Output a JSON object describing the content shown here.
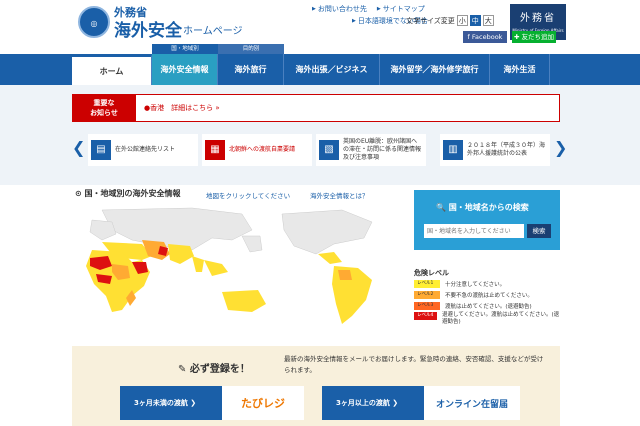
{
  "header": {
    "logo_top": "外務省",
    "logo_main": "海外安全",
    "logo_sub": "ホームページ",
    "links": [
      "お問い合わせ先",
      "サイトマップ",
      "日本語環境でない場合"
    ],
    "font_size_label": "文字サイズ変更",
    "font_sizes": [
      "小",
      "中",
      "大"
    ],
    "mofa": "外務省",
    "mofa_sub": "Ministry of Foreign Affairs of Japan",
    "facebook": "Facebook",
    "line": "友だち追加"
  },
  "subtabs": [
    "国・地域別",
    "目的別"
  ],
  "nav": [
    "ホーム",
    "海外安全情報",
    "海外旅行",
    "海外出張／ビジネス",
    "海外留学／海外修学旅行",
    "海外生活"
  ],
  "notice": {
    "label": "重要な\nお知らせ",
    "text": "●香港　詳細はこちら »"
  },
  "cards": [
    "在外公館連絡先リスト",
    "北朝鮮への渡航自粛要請",
    "英国のEU離脱：欧州諸国への滞在・訪問に係る関連情報及び注意事項",
    "２０１８年（平成３０年）海外邦人援護統計の公表"
  ],
  "map": {
    "title": "国・地域別の海外安全情報",
    "link1": "地図をクリックしてください",
    "link2": "海外安全情報とは？"
  },
  "search": {
    "title": "国・地域名からの検索",
    "placeholder": "国・地域名を入力してください",
    "button": "検索"
  },
  "legend": {
    "title": "危険レベル",
    "items": [
      {
        "level": "レベル1",
        "text": "十分注意してください。",
        "color": "#ffee33"
      },
      {
        "level": "レベル2",
        "text": "不要不急の渡航は止めてください。",
        "color": "#ffaa33"
      },
      {
        "level": "レベル3",
        "text": "渡航は止めてください。(退避勧告)",
        "color": "#ff6622"
      },
      {
        "level": "レベル4",
        "text": "退避してください。渡航は止めてください。(退避勧告)",
        "color": "#dd1111"
      }
    ]
  },
  "register": {
    "title": "必ず登録を！",
    "desc": "最新の海外安全情報をメールでお届けします。緊急時の連絡、安否確認、支援などが受けられます。",
    "btn1": "3ヶ月未満の渡航",
    "logo1": "たびレジ",
    "btn2": "3ヶ月以上の渡航",
    "logo2": "オンライン在留届"
  }
}
